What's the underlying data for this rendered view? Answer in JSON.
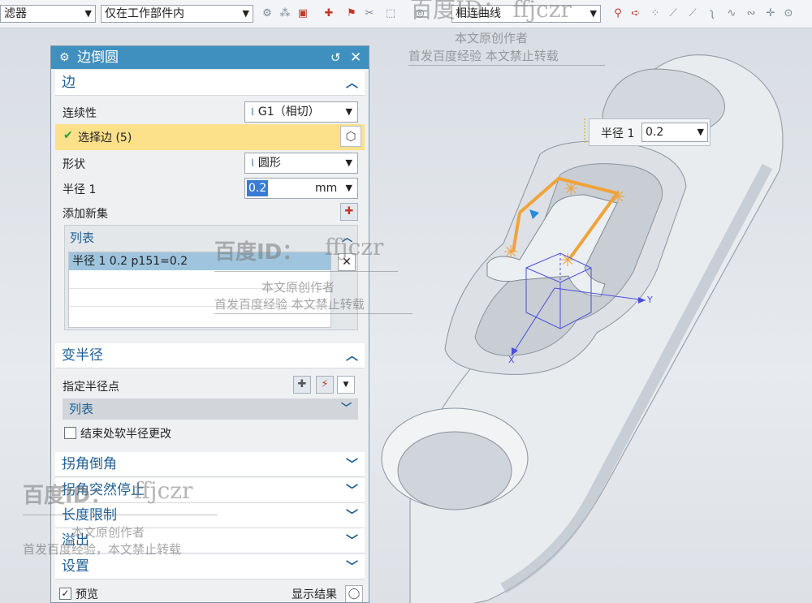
{
  "toolbar": {
    "filter_label": "滤器",
    "scope_value": "仅在工作部件内",
    "curve_rule_value": "相连曲线",
    "icons": [
      "snap-icon",
      "pattern-icon",
      "curve-select-icon",
      "node-icon",
      "feature-icon",
      "box-select-icon",
      "rotate-icon",
      "tangent-icon",
      "arrow-icon",
      "dots-icon",
      "line-icon",
      "line2-icon",
      "spline-icon",
      "wave-icon",
      "cross-icon",
      "circle-icon"
    ]
  },
  "callout": {
    "label": "半径 1",
    "value": "0.2"
  },
  "dialog": {
    "title": "边倒圆",
    "sections": {
      "edge": {
        "title": "边",
        "continuity_label": "连续性",
        "continuity_value": "G1（相切）",
        "select_edge": "选择边 (5)",
        "shape_label": "形状",
        "shape_value": "圆形",
        "radius_label": "半径 1",
        "radius_value": "0.2",
        "radius_unit": "mm",
        "add_new_set": "添加新集",
        "list_title": "列表",
        "list_rows": [
          "半径 1  0.2  p151=0.2"
        ]
      },
      "variable_radius": {
        "title": "变半径",
        "specify_point": "指定半径点",
        "list_title": "列表",
        "soft_change_label": "结束处软半径更改"
      },
      "corner": {
        "title": "拐角倒角"
      },
      "corner_setback": {
        "title": "拐角突然停止"
      },
      "length_limit": {
        "title": "长度限制"
      },
      "overflow": {
        "title": "溢出"
      },
      "settings": {
        "title": "设置"
      },
      "footer": {
        "preview_label": "预览",
        "show_result_label": "显示结果"
      }
    }
  },
  "watermarks": {
    "top_id": "百度ID： ffjczr",
    "mid_id_a": "百度ID：",
    "mid_id_b": "ffjczr",
    "author": "本文原创作者",
    "notice": "首发百度经验    本文禁止转载",
    "bottom_id_a": "百度ID：",
    "bottom_id_b": "ffjczr",
    "bottom_author": "本文原创作者",
    "bottom_notice": "首发百度经验，本文禁止转载"
  },
  "axis_labels": {
    "x": "X",
    "y": "Y"
  },
  "colors": {
    "title_bar": "#3f8fbf",
    "section_text": "#1f5f95",
    "selected_row": "#fde08a",
    "fillet_edge": "#f0a33a"
  }
}
